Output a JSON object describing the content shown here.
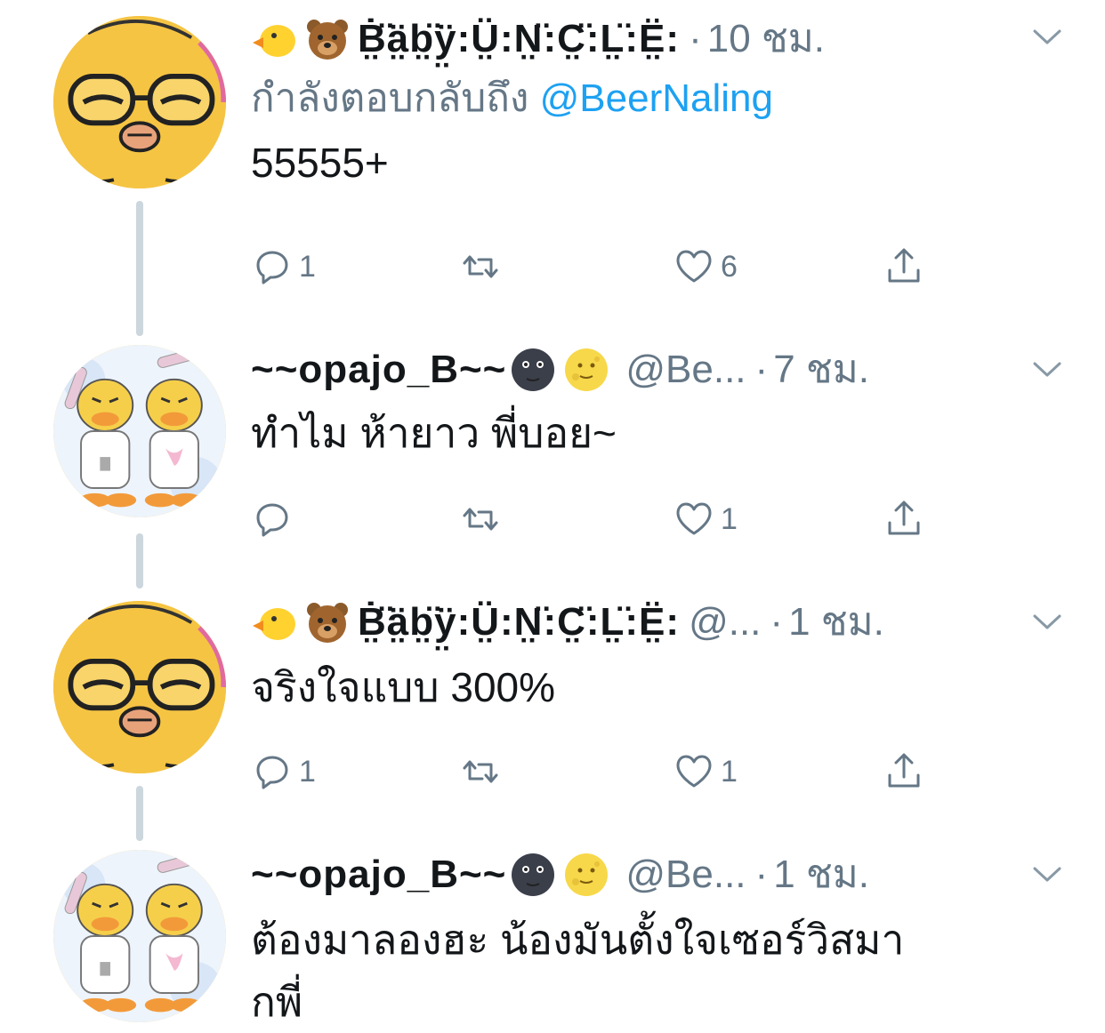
{
  "colors": {
    "text": "#14171a",
    "secondary": "#657786",
    "link": "#1da1f2",
    "line": "#ccd6dd"
  },
  "tweets": [
    {
      "name": "Ḃ̤̈ä̤b̤̈ÿ̤:Ṳ̈:N̤̈:C̤̈:L̤̈:Ë̤:",
      "handle": "",
      "dot": "·",
      "time": "10 ชม.",
      "reply_label": "กำลังตอบกลับถึง",
      "reply_mention": "@BeerNaling",
      "text": "55555+",
      "reply_count": "1",
      "retweet_count": "",
      "like_count": "6",
      "emojis": [
        "baby-chick-icon",
        "bear-face-icon"
      ]
    },
    {
      "name": "~~opajo_B~~",
      "handle": "@Be...",
      "dot": "·",
      "time": "7 ชม.",
      "text": "ทำไม ห้ายาว พี่บอย~",
      "reply_count": "",
      "retweet_count": "",
      "like_count": "1",
      "emojis": [
        "new-moon-face-icon",
        "full-moon-face-icon"
      ]
    },
    {
      "name": "Ḃ̤̈ä̤b̤̈ÿ̤:Ṳ̈:N̤̈:C̤̈:L̤̈:Ë̤:",
      "handle": "@...",
      "dot": "·",
      "time": "1 ชม.",
      "text": "จริงใจแบบ 300%",
      "reply_count": "1",
      "retweet_count": "",
      "like_count": "1",
      "emojis": [
        "baby-chick-icon",
        "bear-face-icon"
      ]
    },
    {
      "name": "~~opajo_B~~",
      "handle": "@Be...",
      "dot": "·",
      "time": "1 ชม.",
      "text_line1": "ต้องมาลองฮะ น้องมันตั้งใจเซอร์วิสมา",
      "text_line2": "กพี่",
      "emojis": [
        "new-moon-face-icon",
        "full-moon-face-icon"
      ]
    }
  ]
}
